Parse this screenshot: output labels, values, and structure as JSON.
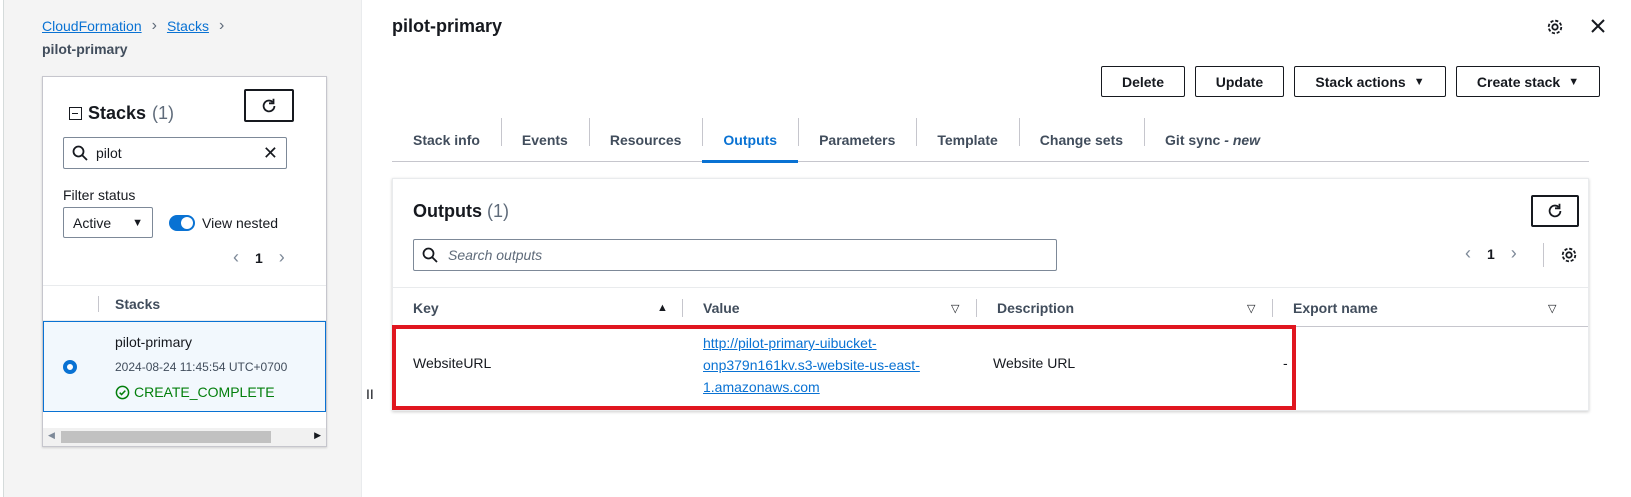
{
  "breadcrumb": {
    "items": [
      "CloudFormation",
      "Stacks"
    ],
    "current": "pilot-primary"
  },
  "stacks_panel": {
    "title": "Stacks",
    "count": "(1)",
    "search_value": "pilot",
    "filter_label": "Filter status",
    "filter_value": "Active",
    "view_nested_label": "View nested",
    "page": "1",
    "column_header": "Stacks",
    "stack": {
      "name": "pilot-primary",
      "date": "2024-08-24 11:45:54 UTC+0700",
      "status": "CREATE_COMPLETE"
    }
  },
  "page": {
    "title": "pilot-primary"
  },
  "actions": {
    "delete": "Delete",
    "update": "Update",
    "stack_actions": "Stack actions",
    "create_stack": "Create stack"
  },
  "tabs": [
    {
      "label": "Stack info"
    },
    {
      "label": "Events"
    },
    {
      "label": "Resources"
    },
    {
      "label": "Outputs"
    },
    {
      "label": "Parameters"
    },
    {
      "label": "Template"
    },
    {
      "label": "Change sets"
    },
    {
      "label": "Git sync",
      "suffix": "- new"
    }
  ],
  "outputs": {
    "title": "Outputs",
    "count": "(1)",
    "search_placeholder": "Search outputs",
    "page": "1",
    "columns": {
      "key": "Key",
      "value": "Value",
      "description": "Description",
      "export": "Export name"
    },
    "rows": [
      {
        "key": "WebsiteURL",
        "value_lines": [
          "http://pilot-primary-uibucket-",
          "onp379n161kv.s3-website-us-east-",
          "1.amazonaws.com"
        ],
        "description": "Website URL",
        "export": "-"
      }
    ]
  },
  "colors": {
    "accent": "#0972d3",
    "success": "#037f0c",
    "highlight": "#e0161f"
  }
}
